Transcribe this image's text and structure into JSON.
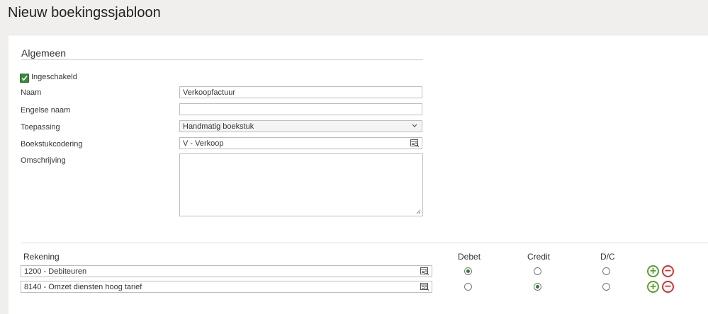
{
  "page": {
    "title": "Nieuw boekingssjabloon"
  },
  "general": {
    "section_title": "Algemeen",
    "enabled_label": "Ingeschakeld",
    "enabled_checked": true,
    "name_label": "Naam",
    "name_value": "Verkoopfactuur",
    "english_name_label": "Engelse naam",
    "english_name_value": "",
    "application_label": "Toepassing",
    "application_value": "Handmatig boekstuk",
    "journal_code_label": "Boekstukcodering",
    "journal_code_value": "V - Verkoop",
    "description_label": "Omschrijving",
    "description_value": ""
  },
  "lines": {
    "headers": {
      "account": "Rekening",
      "debit": "Debet",
      "credit": "Credit",
      "dc": "D/C"
    },
    "rows": [
      {
        "account": "1200 - Debiteuren",
        "selected": "debit"
      },
      {
        "account": "8140 - Omzet diensten hoog tarief",
        "selected": "credit"
      }
    ]
  },
  "colors": {
    "accent_green": "#5aa02c",
    "remove_red": "#d9302c",
    "radio_green": "#2e7d32"
  },
  "icons": [
    "check-icon",
    "chevron-down-icon",
    "lookup-icon",
    "resize-grip-icon",
    "plus-circle-icon",
    "minus-circle-icon"
  ]
}
